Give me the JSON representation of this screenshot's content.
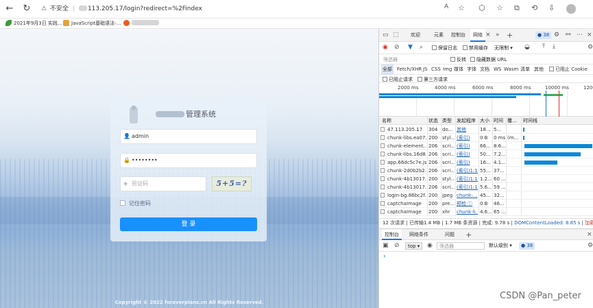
{
  "browser": {
    "security_label": "不安全",
    "url": "113.205.17/login?redirect=%2Findex",
    "reader_icon": "A",
    "bookmarks": [
      {
        "label": "2021年9月3日 实践...",
        "icon": "leaf-icon",
        "color": "#3a9c3a"
      },
      {
        "label": "JavaScript基础语法-...",
        "icon": "folder-icon",
        "color": "#e5a33b"
      },
      {
        "label": "",
        "icon": "firefox-icon",
        "color": "#e85d1f"
      }
    ]
  },
  "login": {
    "title_suffix": "管理系统",
    "username_value": "admin",
    "password_value": "••••••••",
    "captcha_placeholder": "验证码",
    "captcha_text": "5+5=?",
    "remember_label": "记住密码",
    "login_button": "登 录",
    "copyright": "Copyright © 2022 foreverplans.cn All Rights Reserved."
  },
  "devtools": {
    "tabs": [
      "欢迎",
      "元素",
      "控制台",
      "网络"
    ],
    "active_tab": "网络",
    "issue_count": "38",
    "toolbar": {
      "preserve_log": "保留日志",
      "disable_cache": "禁用缓存",
      "throttle": "无限制"
    },
    "filter": {
      "placeholder": "筛选器",
      "invert": "反转",
      "hide_data_urls": "隐藏数据 URL"
    },
    "type_filters": [
      "全部",
      "Fetch/XHR",
      "JS",
      "CSS",
      "Img",
      "媒体",
      "字体",
      "文档",
      "WS",
      "Wasm",
      "清单",
      "其他"
    ],
    "blocked_cookies": "已阻止 Cookie",
    "blocked_requests": "已阻止请求",
    "third_party": "第三方请求",
    "timeline_ticks": [
      "2000 ms",
      "4000 ms",
      "6000 ms",
      "8000 ms",
      "10000 ms",
      "1200"
    ],
    "columns": [
      "名称",
      "状态",
      "类型",
      "发起程序",
      "大小",
      "时间",
      "覆...",
      "时间线"
    ],
    "rows": [
      {
        "name": "47.113.205.17",
        "status": "304",
        "type": "do...",
        "initiator": "其他",
        "size": "18...",
        "time": "5...",
        "extra": "",
        "wf_start": 0.01,
        "wf_len": 0.01
      },
      {
        "name": "chunk-libs.ea07...",
        "status": "200",
        "type": "styl...",
        "initiator": "(索引)",
        "size": "0 B",
        "time": "0 ms",
        "extra": "(m...",
        "wf_start": 0.01,
        "wf_len": 0.005
      },
      {
        "name": "chunk-element...",
        "status": "206",
        "type": "scri...",
        "initiator": "(索引)",
        "size": "66...",
        "time": "8.6...",
        "extra": "",
        "wf_start": 0.03,
        "wf_len": 0.97
      },
      {
        "name": "chunk-libs.16d8...",
        "status": "206",
        "type": "scri...",
        "initiator": "(索引)",
        "size": "50...",
        "time": "7.2...",
        "extra": "",
        "wf_start": 0.03,
        "wf_len": 0.8
      },
      {
        "name": "app.66dc5c7e.js",
        "status": "206",
        "type": "scri...",
        "initiator": "(索引)",
        "size": "16...",
        "time": "4.1...",
        "extra": "",
        "wf_start": 0.03,
        "wf_len": 0.47
      },
      {
        "name": "chunk-2d0b2b2...",
        "status": "206",
        "type": "scri...",
        "initiator": "(索引)1:1...",
        "size": "55...",
        "time": "37...",
        "extra": "",
        "wf_start": 0.0,
        "wf_len": 0.0
      },
      {
        "name": "chunk-4b13017...",
        "status": "200",
        "type": "styl...",
        "initiator": "(索引)1:1...",
        "size": "1.2...",
        "time": "60 ...",
        "extra": "",
        "wf_start": 0.0,
        "wf_len": 0.0
      },
      {
        "name": "chunk-4b13017...",
        "status": "206",
        "type": "scri...",
        "initiator": "(索引)1:1...",
        "size": "5.6...",
        "time": "59 ...",
        "extra": "",
        "wf_start": 0.0,
        "wf_len": 0.0
      },
      {
        "name": "login-bg.86bc2f...",
        "status": "200",
        "type": "jpeg",
        "initiator": "chunk-...",
        "size": "45...",
        "time": "32...",
        "extra": "",
        "wf_start": 0.0,
        "wf_len": 0.0
      },
      {
        "name": "captchaImage",
        "status": "200",
        "type": "pre...",
        "initiator": "预检 ⓘ",
        "size": "0 B",
        "time": "46...",
        "extra": "",
        "wf_start": 0.0,
        "wf_len": 0.0
      },
      {
        "name": "captchaImage",
        "status": "200",
        "type": "xhr",
        "initiator": "chunk-li...",
        "size": "4.6...",
        "time": "65 ...",
        "extra": "",
        "wf_start": 0.0,
        "wf_len": 0.0
      }
    ],
    "summary": {
      "requests": "12 次请求",
      "transferred": "已传输1.4 MB",
      "resources": "1.7 MB 条资源",
      "finish": "完成: 9.78 s",
      "dcl": "DOMContentLoaded: 8.85 s",
      "load": "加载: 9.55 s"
    },
    "drawer_tabs": [
      "控制台",
      "网络条件",
      "问题"
    ],
    "console": {
      "context": "top",
      "filter_placeholder": "筛选器",
      "level": "默认级别",
      "issues": "38",
      "prompt": "›"
    }
  },
  "watermark": "CSDN @Pan_peter"
}
